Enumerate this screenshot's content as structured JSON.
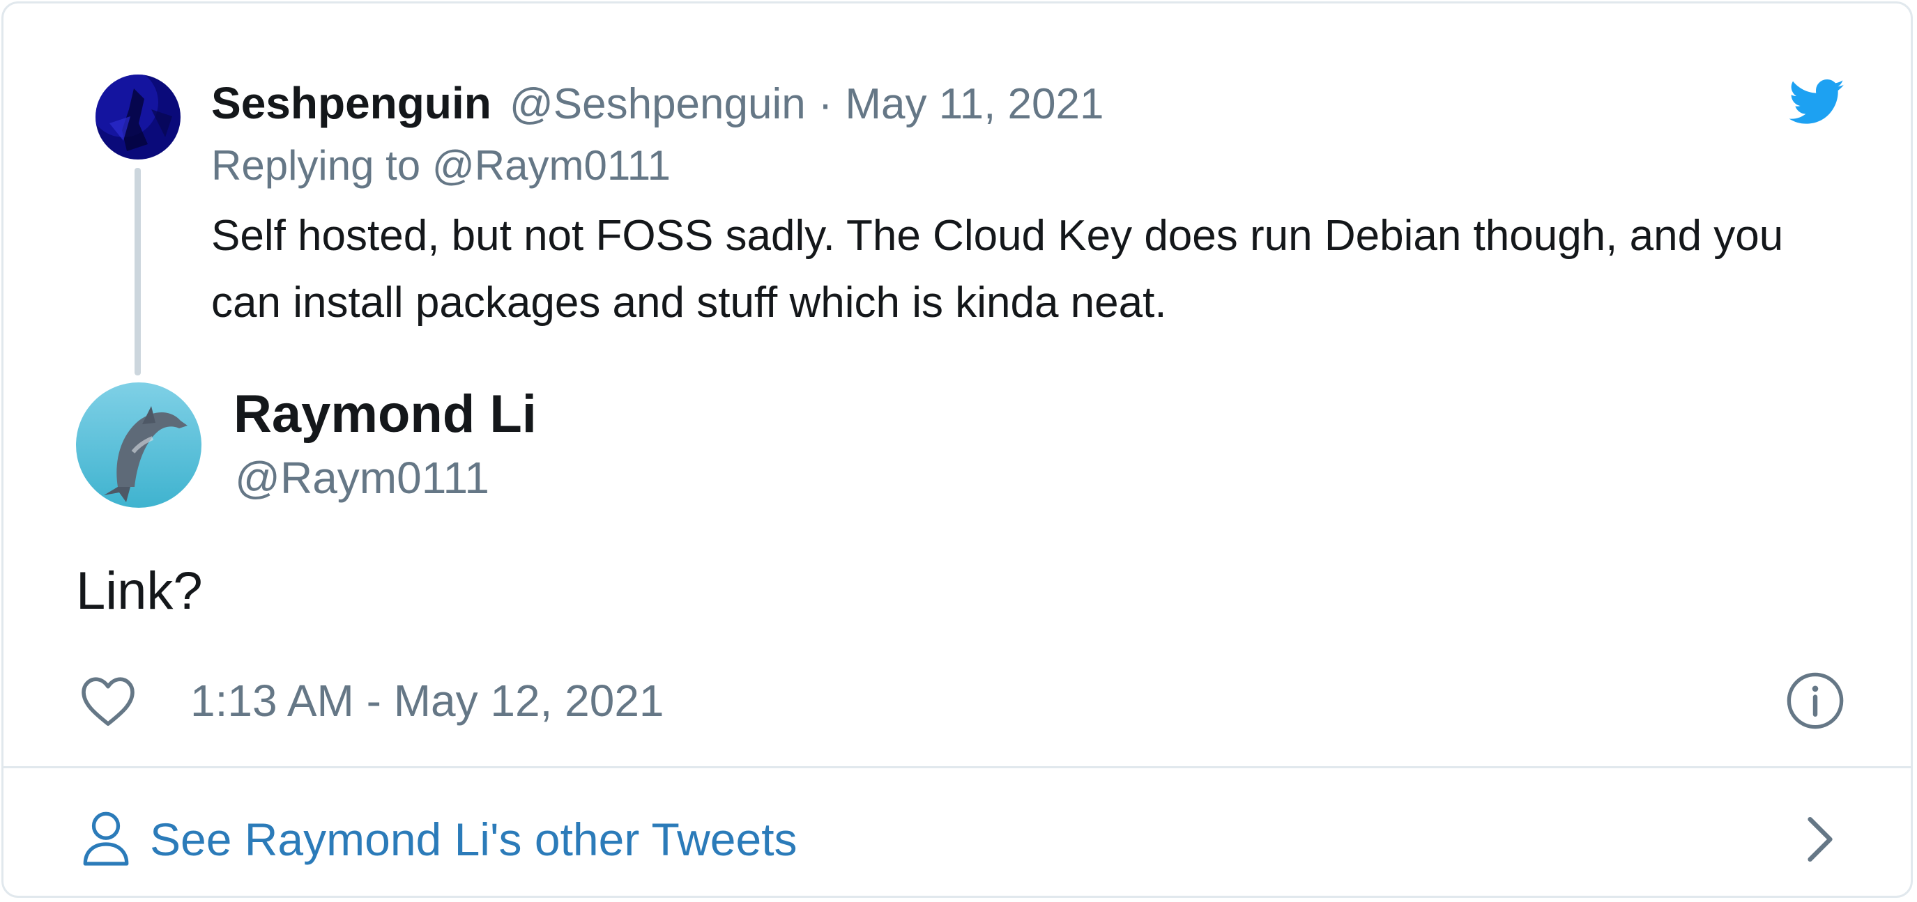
{
  "parent_tweet": {
    "author_name": "Seshpenguin",
    "author_handle": "@Seshpenguin",
    "separator": "·",
    "date": "May 11, 2021",
    "replying_prefix": "Replying to",
    "replying_to": "@Raym0111",
    "text": "Self hosted, but not FOSS sadly. The Cloud Key does run Debian though, and you can install packages and stuff which is kinda neat.",
    "avatar_icon": "penguin-avatar",
    "avatar_color": "#10109a"
  },
  "main_tweet": {
    "author_name": "Raymond Li",
    "author_handle": "@Raym0111",
    "text": "Link?",
    "timestamp": "1:13 AM - May 12, 2021",
    "avatar_icon": "dolphin-avatar",
    "avatar_color": "#5bc0d8"
  },
  "footer": {
    "label": "See Raymond Li's other Tweets"
  },
  "icons": {
    "brand": "twitter-bird-icon",
    "like": "heart-icon",
    "info": "info-icon",
    "profile": "person-icon",
    "more": "chevron-right-icon"
  },
  "colors": {
    "twitter_blue": "#1da1f2",
    "link_blue": "#2b7bb9",
    "text_primary": "#14171a",
    "text_secondary": "#657786",
    "border": "#e1e8ed"
  }
}
